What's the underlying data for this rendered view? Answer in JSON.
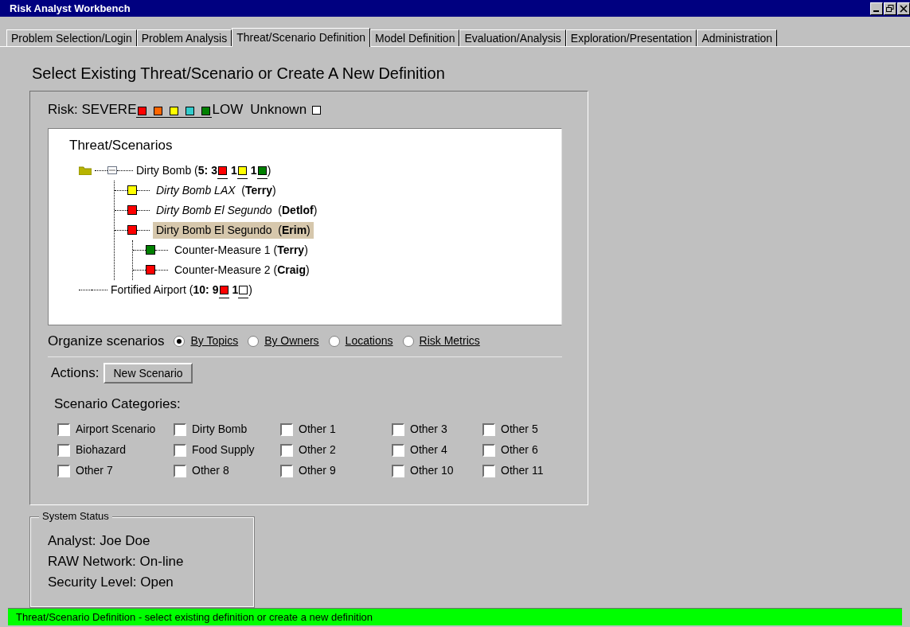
{
  "window": {
    "title": "Risk Analyst Workbench"
  },
  "tabs": [
    {
      "label": "Problem Selection/Login",
      "selected": false
    },
    {
      "label": "Problem Analysis",
      "selected": false
    },
    {
      "label": "Threat/Scenario Definition",
      "selected": true
    },
    {
      "label": "Model Definition",
      "selected": false
    },
    {
      "label": "Evaluation/Analysis",
      "selected": false
    },
    {
      "label": "Exploration/Presentation",
      "selected": false
    },
    {
      "label": "Administration",
      "selected": false
    }
  ],
  "heading": "Select Existing Threat/Scenario or Create A New Definition",
  "risk_legend": {
    "label": "Risk: SEVERE",
    "low_label": "LOW",
    "unknown_label": "Unknown",
    "unknown_swatch": {
      "color": "#ffffff"
    },
    "levels": [
      {
        "color": "#ff0000"
      },
      {
        "color": "#ff6600"
      },
      {
        "color": "#ffff00"
      },
      {
        "color": "#33cccc"
      },
      {
        "color": "#008000"
      }
    ]
  },
  "tree": {
    "title": "Threat/Scenarios",
    "nodes": [
      {
        "kind": "topic",
        "label": "Dirty Bomb (**5:**",
        "expanded": true,
        "counts": [
          {
            "count": "3",
            "color": "#ff0000"
          },
          {
            "count": "1",
            "color": "#ffff00"
          },
          {
            "count": "1",
            "color": "#008000"
          }
        ],
        "close": ")",
        "children": [
          {
            "kind": "scenario",
            "text": "*Dirty Bomb LAX*  (**Terry**)",
            "selected": false,
            "color": "#ffff00"
          },
          {
            "kind": "scenario",
            "text": "*Dirty Bomb El Segundo*  (**Detlof**)",
            "selected": false,
            "color": "#ff0000"
          },
          {
            "kind": "scenario",
            "text": "Dirty Bomb El Segundo  (**Erim**)",
            "selected": true,
            "color": "#ff0000",
            "children": [
              {
                "kind": "scenario",
                "text": "Counter-Measure 1 (**Terry**)",
                "selected": false,
                "color": "#008000"
              },
              {
                "kind": "scenario",
                "text": "Counter-Measure 2 (**Craig**)",
                "selected": false,
                "color": "#ff0000"
              }
            ]
          }
        ]
      },
      {
        "kind": "topic",
        "label": "Fortified Airport (**10:**",
        "counts": [
          {
            "count": "9",
            "color": "#ff0000"
          },
          {
            "count": "1",
            "color": "#ffffff"
          }
        ],
        "close": ")"
      }
    ]
  },
  "organize": {
    "label": "Organize scenarios",
    "options": [
      {
        "label": "By Topics",
        "selected": true
      },
      {
        "label": "By Owners",
        "selected": false
      },
      {
        "label": "Locations",
        "selected": false
      },
      {
        "label": "Risk Metrics",
        "selected": false
      }
    ]
  },
  "actions": {
    "label": "Actions:",
    "buttons": [
      "New Scenario"
    ]
  },
  "categories": {
    "label": "Scenario Categories:",
    "items": [
      {
        "label": "Airport Scenario",
        "checked": false
      },
      {
        "label": "Dirty Bomb",
        "checked": false
      },
      {
        "label": "Other 1",
        "checked": false
      },
      {
        "label": "Other 3",
        "checked": false
      },
      {
        "label": "Other 5",
        "checked": false
      },
      {
        "label": "Biohazard",
        "checked": false
      },
      {
        "label": "Food Supply",
        "checked": false
      },
      {
        "label": "Other 2",
        "checked": false
      },
      {
        "label": "Other 4",
        "checked": false
      },
      {
        "label": "Other 6",
        "checked": false
      },
      {
        "label": "Other 7",
        "checked": false
      },
      {
        "label": "Other 8",
        "checked": false
      },
      {
        "label": "Other 9",
        "checked": false
      },
      {
        "label": "Other 10",
        "checked": false
      },
      {
        "label": "Other 11",
        "checked": false
      }
    ]
  },
  "system_status": {
    "title": "System Status",
    "lines": [
      "Analyst: Joe Doe",
      "RAW Network: On-line",
      "Security Level: Open"
    ]
  },
  "status_bar": "Threat/Scenario Definition - select existing definition or create a new definition"
}
